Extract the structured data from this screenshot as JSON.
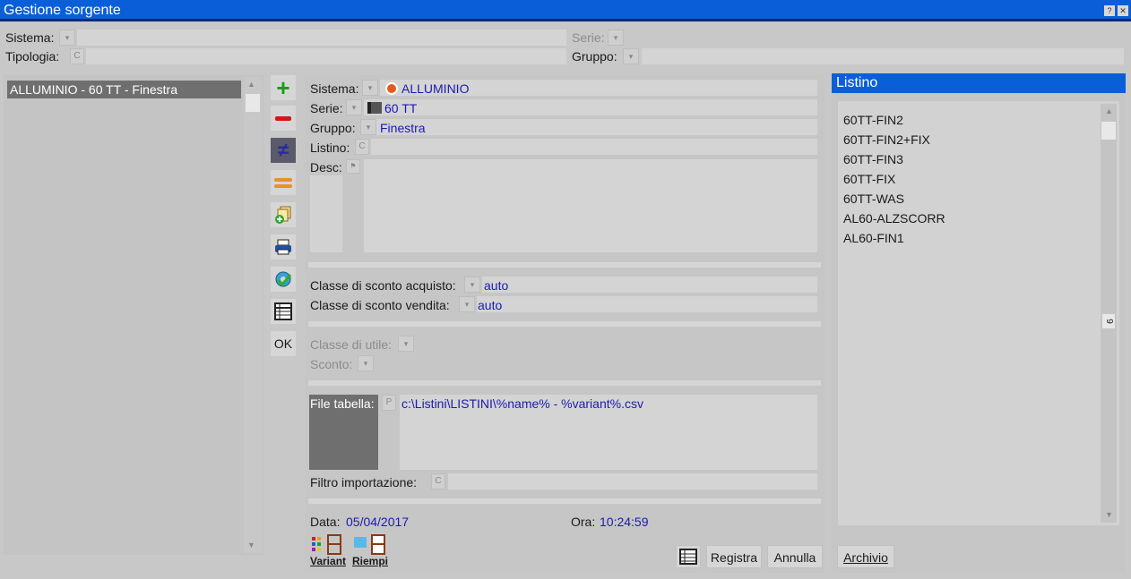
{
  "window": {
    "title": "Gestione sorgente",
    "help_label": "?",
    "close_label": "✕"
  },
  "filters": {
    "sistema_label": "Sistema:",
    "serie_label": "Serie:",
    "tipologia_label": "Tipologia:",
    "gruppo_label": "Gruppo:",
    "dropdown_glyph": "▾",
    "c_glyph": "C"
  },
  "left_list": {
    "items": [
      "ALLUMINIO - 60 TT - Finestra"
    ]
  },
  "toolbar": {
    "add": "+",
    "remove": "−",
    "not_equal": "≠",
    "equal": "=",
    "ok_label": "OK",
    "colors": {
      "add": "#1a9a1a",
      "remove": "#d01818",
      "not_equal": "#2a2a9a",
      "equal": "#e8902a"
    }
  },
  "form": {
    "sistema_label": "Sistema:",
    "sistema_value": "ALLUMINIO",
    "serie_label": "Serie:",
    "serie_value": "60 TT",
    "gruppo_label": "Gruppo:",
    "gruppo_value": "Finestra",
    "listino_label": "Listino:",
    "desc_label": "Desc:",
    "classe_acquisto_label": "Classe di sconto acquisto:",
    "classe_acquisto_value": "auto",
    "classe_vendita_label": "Classe di sconto vendita:",
    "classe_vendita_value": "auto",
    "classe_utile_label": "Classe di utile:",
    "sconto_label": "Sconto:",
    "file_tabella_label": "File tabella:",
    "file_tabella_btn": "P",
    "file_tabella_value": "c:\\Listini\\LISTINI\\%name% - %variant%.csv",
    "filtro_label": "Filtro importazione:",
    "data_label": "Data:",
    "data_value": "05/04/2017",
    "ora_label": "Ora:",
    "ora_value": "10:24:59",
    "variant_label": "Variant",
    "riempi_label": "Riempi",
    "registra_label": "Registra",
    "annulla_label": "Annulla"
  },
  "listino": {
    "header": "Listino",
    "items": [
      "60TT-FIN2",
      "60TT-FIN2+FIX",
      "60TT-FIN3",
      "60TT-FIX",
      "60TT-WAS",
      "AL60-ALZSCORR",
      "AL60-FIN1"
    ],
    "scroll_count": "9",
    "archivio_label": "Archivio"
  },
  "colors": {
    "titlebar": "#0a5fd8",
    "value_text": "#1a1ab4",
    "selection": "#6f6f6f"
  }
}
